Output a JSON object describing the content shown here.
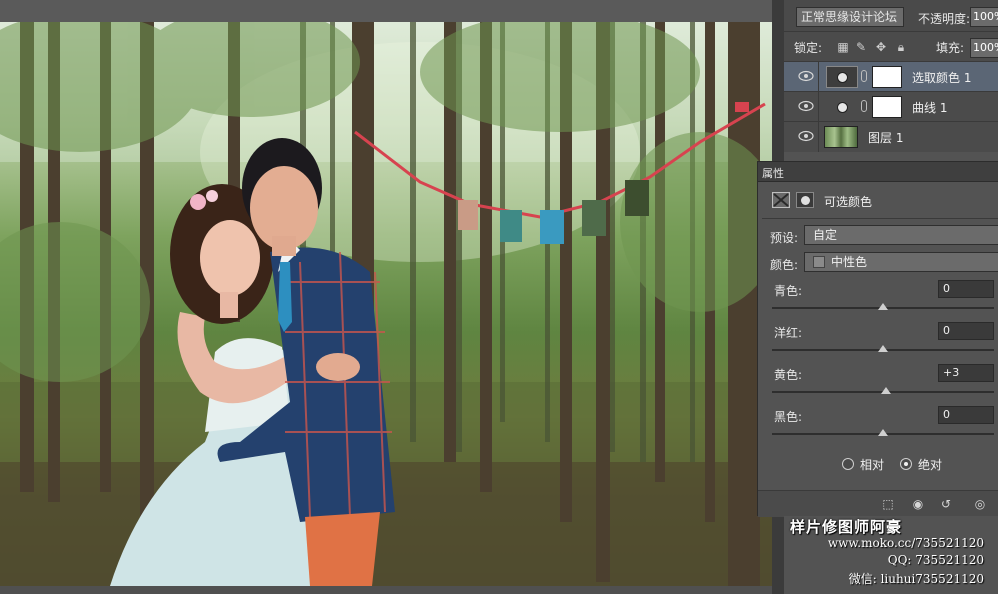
{
  "layers_panel": {
    "blend_mode": "正常思缘设计论坛",
    "opacity_label": "不透明度:",
    "opacity_value": "100%",
    "lock_label": "锁定:",
    "fill_label": "填充:",
    "fill_value": "100%",
    "layers": [
      {
        "name": "选取颜色 1",
        "kind": "adjustment",
        "active": true
      },
      {
        "name": "曲线 1",
        "kind": "adjustment",
        "active": false
      },
      {
        "name": "图层 1",
        "kind": "pixel",
        "active": false
      }
    ]
  },
  "properties_panel": {
    "tab": "属性",
    "title": "可选颜色",
    "preset_label": "预设:",
    "preset_value": "自定",
    "color_label": "颜色:",
    "color_value": "中性色",
    "sliders": [
      {
        "label": "青色:",
        "value": "0",
        "position": 0.5
      },
      {
        "label": "洋红:",
        "value": "0",
        "position": 0.5
      },
      {
        "label": "黄色:",
        "value": "+3",
        "position": 0.515
      },
      {
        "label": "黑色:",
        "value": "0",
        "position": 0.5
      }
    ],
    "mode_relative": "相对",
    "mode_absolute": "绝对",
    "selected_mode": "absolute"
  },
  "watermark": {
    "title": "样片修图师阿豪",
    "site": "www.moko.cc/735521120",
    "qq": "QQ: 735521120",
    "wechat": "微信: liuhui735521120"
  }
}
